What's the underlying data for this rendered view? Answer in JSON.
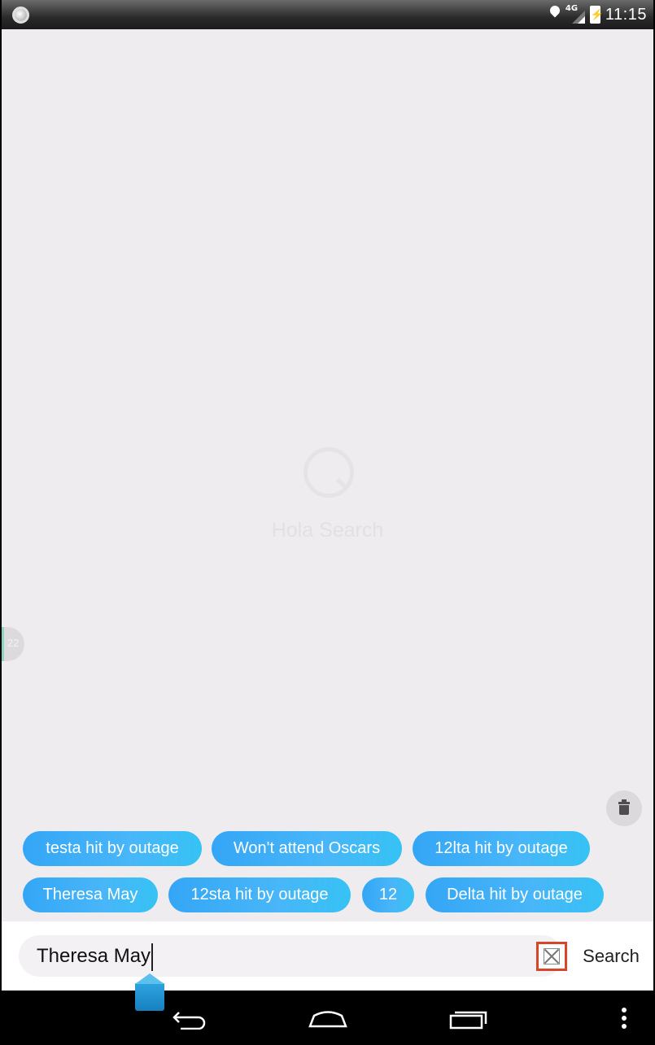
{
  "status_bar": {
    "network_label": "4G",
    "time": "11:15"
  },
  "app": {
    "logo_text": "Hola Search",
    "side_tab_label": "22"
  },
  "chips": [
    {
      "label": "testa hit by outage"
    },
    {
      "label": "Won't attend Oscars"
    },
    {
      "label": "12lta hit by outage"
    },
    {
      "label": "Theresa May"
    },
    {
      "label": "12sta hit by outage"
    },
    {
      "label": "12"
    },
    {
      "label": "Delta hit by outage"
    }
  ],
  "search": {
    "value": "Theresa May",
    "button_label": "Search"
  },
  "colors": {
    "chip": "#3fb0f7",
    "clear_highlight": "#d9452b",
    "background": "#efecef"
  }
}
